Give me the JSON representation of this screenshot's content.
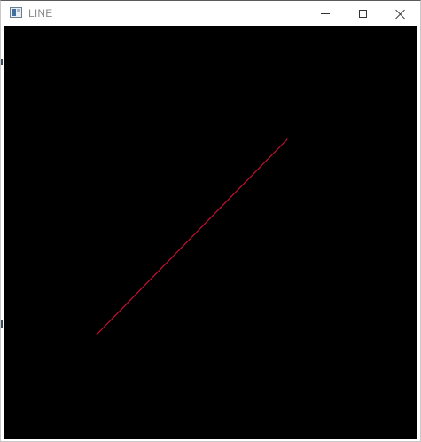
{
  "window": {
    "title": "LINE",
    "app_icon": "window-app-icon",
    "controls": {
      "minimize_icon": "minimize-icon",
      "maximize_icon": "maximize-icon",
      "close_icon": "close-icon"
    }
  },
  "canvas": {
    "background_color": "#000000",
    "line_color": "#c8102e"
  }
}
